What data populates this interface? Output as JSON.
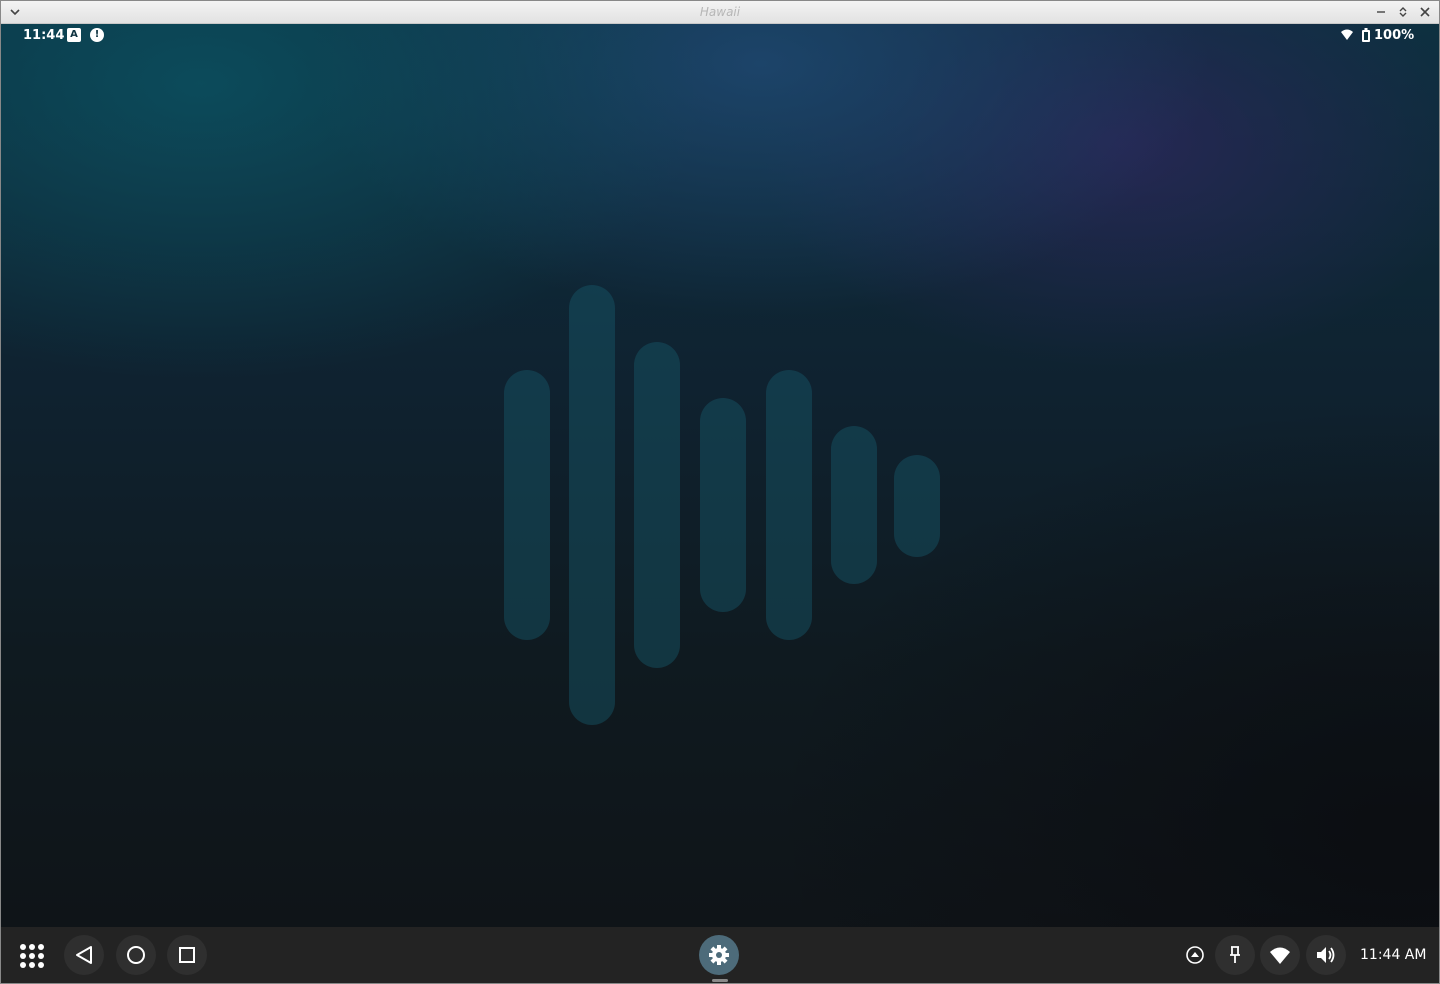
{
  "window": {
    "title": "Hawaii"
  },
  "statusbar": {
    "time": "11:44",
    "notif_a": "A",
    "notif_alert": "!",
    "battery_percent": "100%"
  },
  "taskbar": {
    "clock": "11:44 AM"
  },
  "icons": {
    "window_menu": "chevron-down-icon",
    "minimize": "minimize-icon",
    "maximize": "maximize-icon",
    "close": "close-icon",
    "apps": "app-grid-icon",
    "back": "back-triangle-icon",
    "home": "home-circle-icon",
    "recent": "recent-square-icon",
    "settings": "gear-icon",
    "tray_up": "chevron-up-circle-icon",
    "pin": "pin-icon",
    "wifi": "wifi-icon",
    "volume": "volume-icon",
    "battery": "battery-icon"
  },
  "colors": {
    "taskbar": "#232323",
    "settings_button": "#4d6b7a",
    "logo_bars": "#16586a"
  }
}
